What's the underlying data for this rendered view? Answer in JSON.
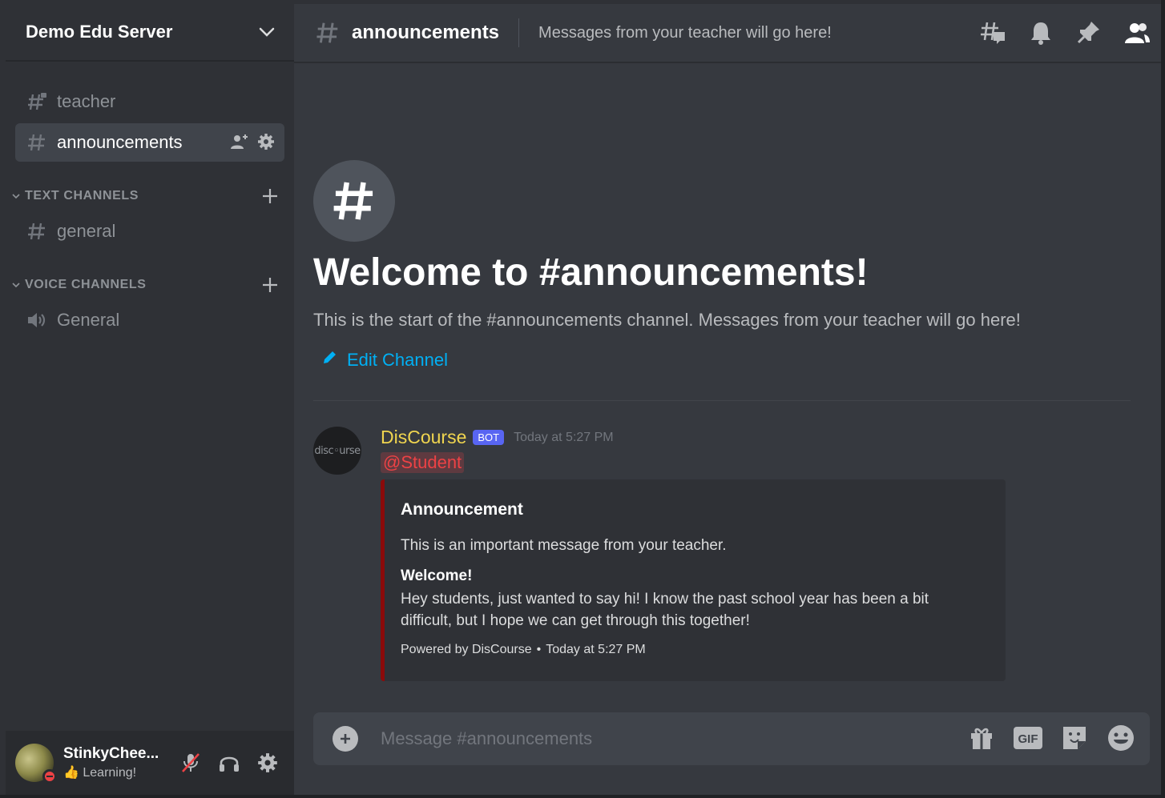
{
  "colors": {
    "sidebar_bg": "#2f3136",
    "main_bg": "#36393f",
    "accent_link": "#00b0f4",
    "mention": "#ed4245",
    "bot_tag": "#5865f2",
    "author": "#f0d54f",
    "embed_border": "#8b0a0a",
    "dnd_status": "#ed4245"
  },
  "server": {
    "name": "Demo Edu Server",
    "menu_icon": "chevron-down-icon"
  },
  "sidebar": {
    "channels_top": [
      {
        "label": "teacher",
        "icon": "locked-text-channel-icon",
        "active": false
      },
      {
        "label": "announcements",
        "icon": "text-channel-icon",
        "active": true,
        "tools": [
          "invite-icon",
          "gear-icon"
        ]
      }
    ],
    "categories": [
      {
        "label": "TEXT CHANNELS",
        "channels": [
          {
            "label": "general",
            "icon": "text-channel-icon"
          }
        ]
      },
      {
        "label": "VOICE CHANNELS",
        "channels": [
          {
            "label": "General",
            "icon": "speaker-icon"
          }
        ]
      }
    ]
  },
  "user": {
    "name": "StinkyChee...",
    "status_emoji": "👍",
    "status_text": "Learning!",
    "status": "do-not-disturb",
    "controls": [
      "mute-mic-icon",
      "headphones-icon",
      "gear-icon"
    ]
  },
  "topbar": {
    "channel": "announcements",
    "topic": "Messages from your teacher will go here!",
    "tools": [
      "threads-icon",
      "bell-icon",
      "pin-icon",
      "members-icon"
    ]
  },
  "welcome": {
    "title": "Welcome to #announcements!",
    "subtitle": "This is the start of the #announcements channel. Messages from your teacher will go here!",
    "edit_label": "Edit Channel"
  },
  "message": {
    "avatar_text": "disc◦urse",
    "author": "DisCourse",
    "bot_tag": "BOT",
    "timestamp": "Today at 5:27 PM",
    "mention": "@Student",
    "embed": {
      "title": "Announcement",
      "description": "This is an important message from your teacher.",
      "field_name": "Welcome!",
      "field_value": "Hey students, just wanted to say hi! I know the past school year has been a bit difficult, but I hope we can get through this together!",
      "footer_text": "Powered by DisCourse",
      "footer_separator": "•",
      "footer_time": "Today at 5:27 PM"
    }
  },
  "composer": {
    "placeholder": "Message #announcements",
    "gif_label": "GIF",
    "tools": [
      "gift-icon",
      "gif-icon",
      "sticker-icon",
      "emoji-icon"
    ]
  }
}
